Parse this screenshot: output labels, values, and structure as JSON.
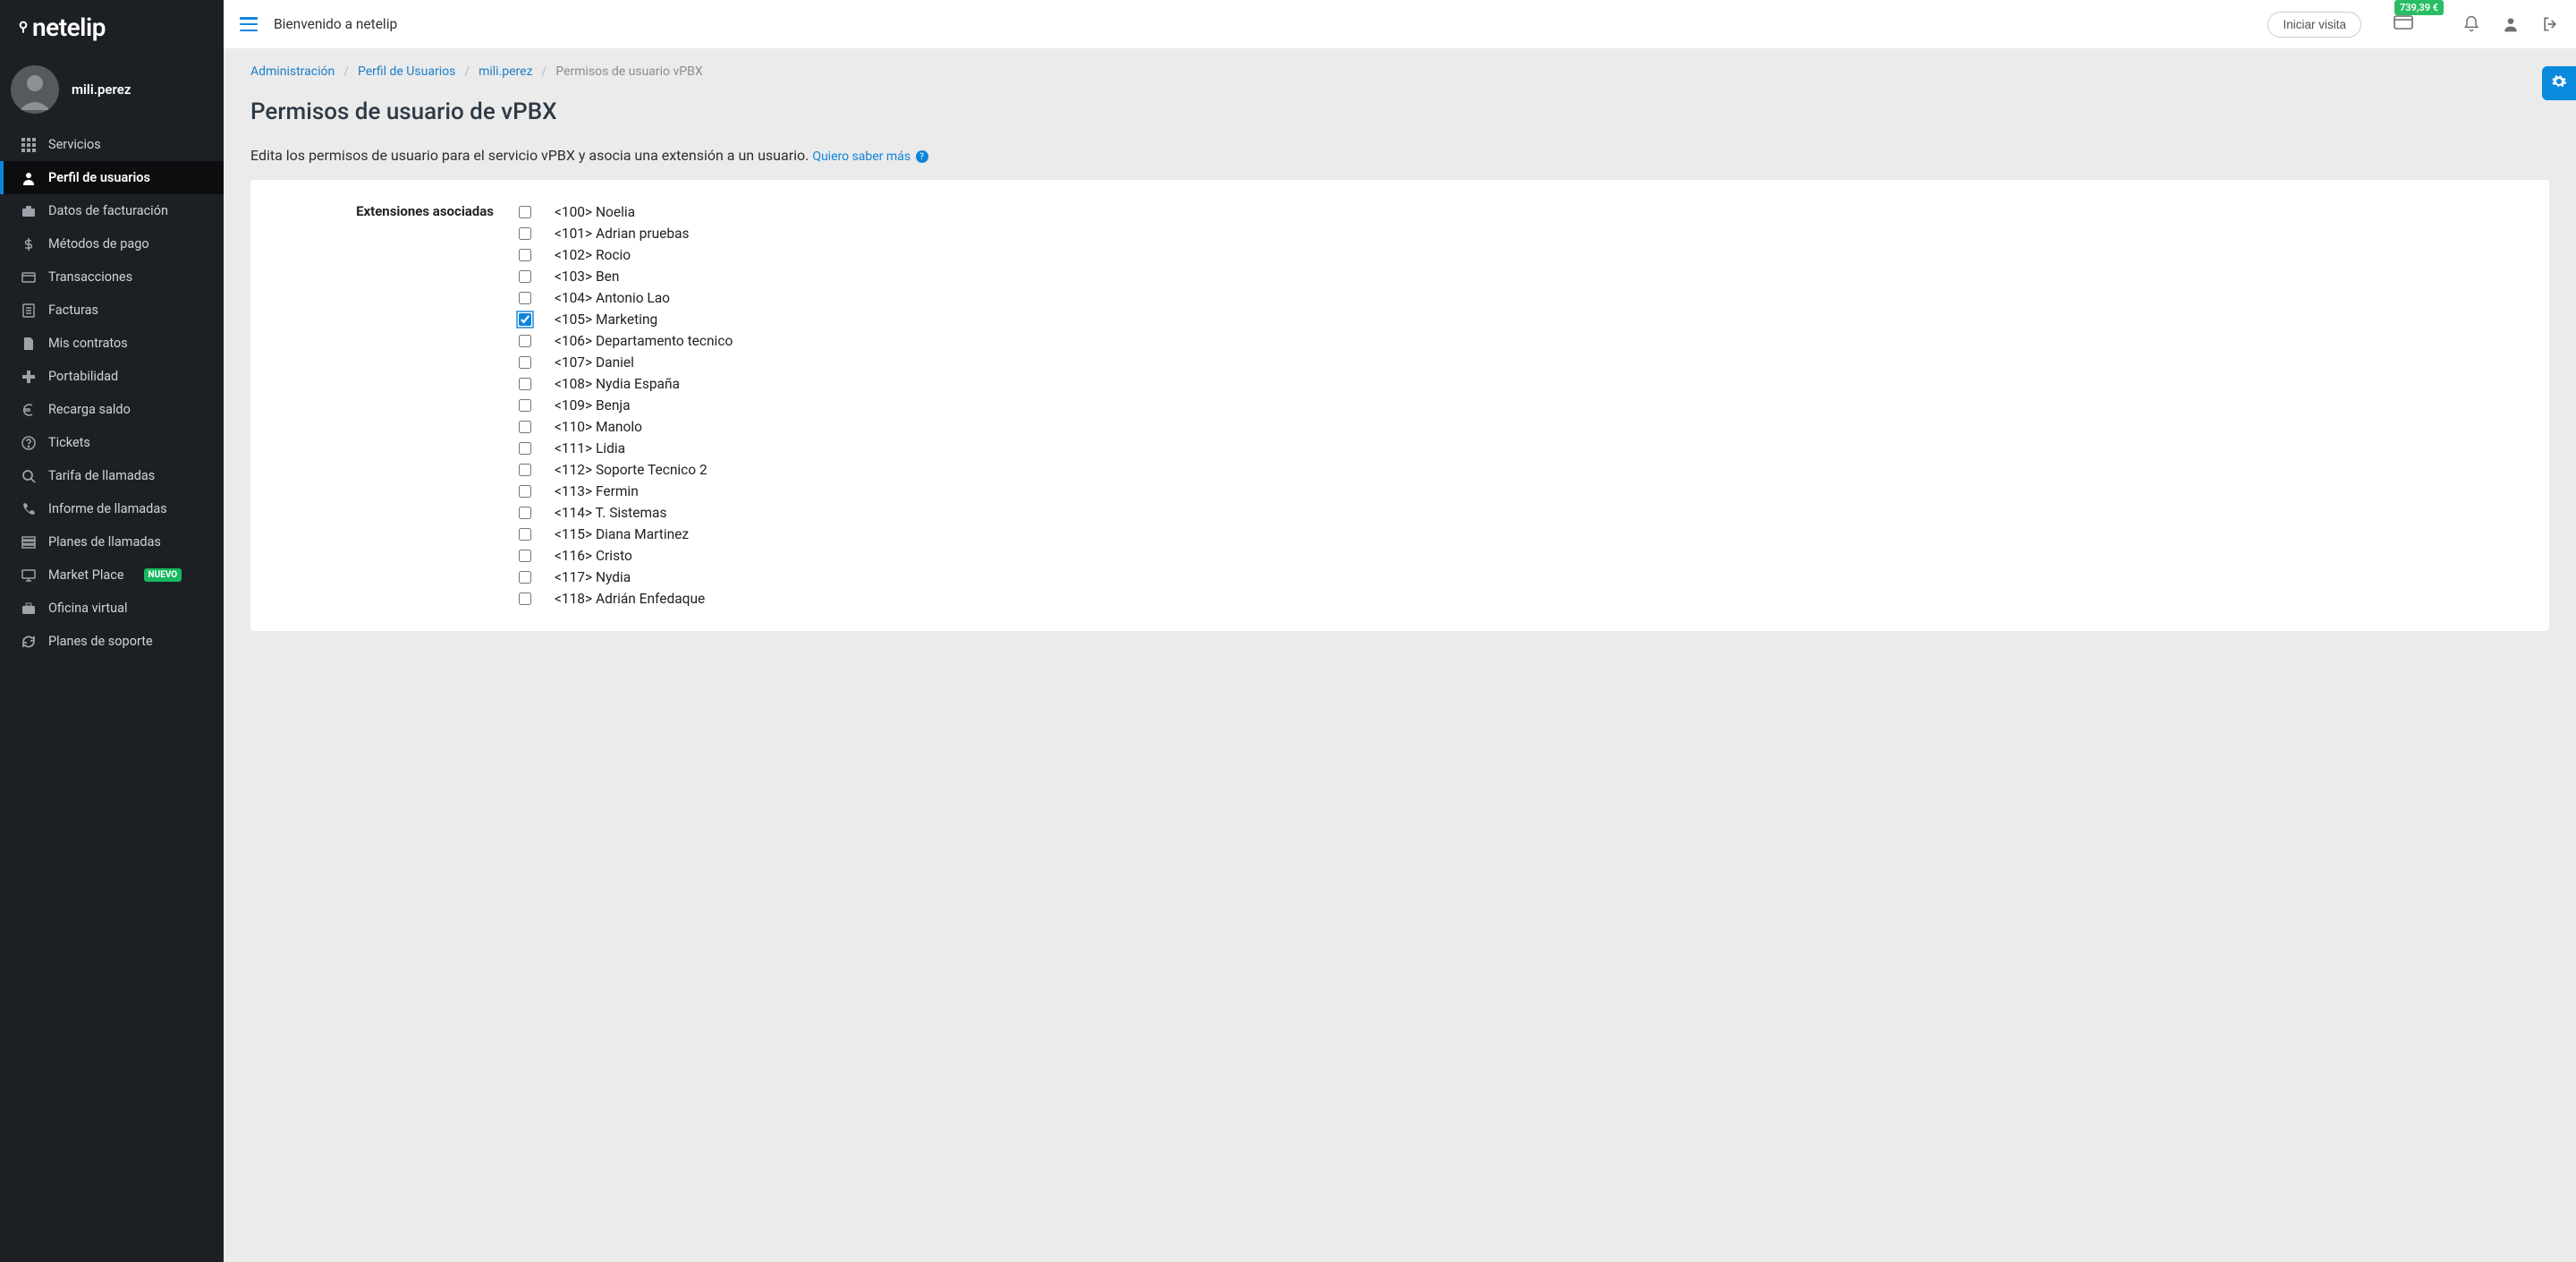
{
  "logo_text": "netelip",
  "user": {
    "name": "mili.perez"
  },
  "topbar": {
    "welcome": "Bienvenido a netelip",
    "start_visit": "Iniciar visita",
    "balance": "739,39 €"
  },
  "sidebar": {
    "items": [
      {
        "label": "Servicios",
        "icon": "grid"
      },
      {
        "label": "Perfil de usuarios",
        "icon": "user",
        "active": true
      },
      {
        "label": "Datos de facturación",
        "icon": "briefcase"
      },
      {
        "label": "Métodos de pago",
        "icon": "dollar"
      },
      {
        "label": "Transacciones",
        "icon": "card"
      },
      {
        "label": "Facturas",
        "icon": "file"
      },
      {
        "label": "Mis contratos",
        "icon": "doc"
      },
      {
        "label": "Portabilidad",
        "icon": "plus"
      },
      {
        "label": "Recarga saldo",
        "icon": "euro"
      },
      {
        "label": "Tickets",
        "icon": "help"
      },
      {
        "label": "Tarifa de llamadas",
        "icon": "search"
      },
      {
        "label": "Informe de llamadas",
        "icon": "phone"
      },
      {
        "label": "Planes de llamadas",
        "icon": "stack"
      },
      {
        "label": "Market Place",
        "icon": "monitor",
        "badge": "NUEVO"
      },
      {
        "label": "Oficina virtual",
        "icon": "briefcase2"
      },
      {
        "label": "Planes de soporte",
        "icon": "refresh"
      }
    ]
  },
  "breadcrumb": {
    "items": [
      {
        "label": "Administración",
        "link": true
      },
      {
        "label": "Perfil de Usuarios",
        "link": true
      },
      {
        "label": "mili.perez",
        "link": true
      },
      {
        "label": "Permisos de usuario vPBX",
        "link": false
      }
    ]
  },
  "page": {
    "title": "Permisos de usuario de vPBX",
    "description": "Edita los permisos de usuario para el servicio vPBX y asocia una extensión a un usuario.",
    "help_text": "Quiero saber más"
  },
  "extensions": {
    "label": "Extensiones asociadas",
    "items": [
      {
        "text": "<100> Noelia",
        "checked": false
      },
      {
        "text": "<101> Adrian pruebas",
        "checked": false
      },
      {
        "text": "<102> Rocio",
        "checked": false
      },
      {
        "text": "<103> Ben",
        "checked": false
      },
      {
        "text": "<104> Antonio Lao",
        "checked": false
      },
      {
        "text": "<105> Marketing",
        "checked": true
      },
      {
        "text": "<106> Departamento tecnico",
        "checked": false
      },
      {
        "text": "<107> Daniel",
        "checked": false
      },
      {
        "text": "<108> Nydia España",
        "checked": false
      },
      {
        "text": "<109> Benja",
        "checked": false
      },
      {
        "text": "<110> Manolo",
        "checked": false
      },
      {
        "text": "<111> Lidia",
        "checked": false
      },
      {
        "text": "<112> Soporte Tecnico 2",
        "checked": false
      },
      {
        "text": "<113> Fermin",
        "checked": false
      },
      {
        "text": "<114> T. Sistemas",
        "checked": false
      },
      {
        "text": "<115> Diana Martinez",
        "checked": false
      },
      {
        "text": "<116> Cristo",
        "checked": false
      },
      {
        "text": "<117> Nydia",
        "checked": false
      },
      {
        "text": "<118> Adrián Enfedaque",
        "checked": false
      }
    ]
  }
}
